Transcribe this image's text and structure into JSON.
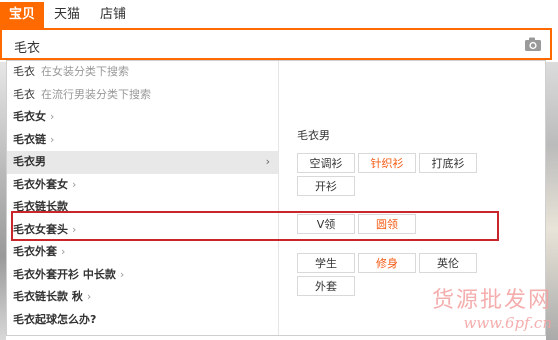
{
  "tabs": [
    {
      "label": "宝贝",
      "active": true
    },
    {
      "label": "天猫",
      "active": false
    },
    {
      "label": "店铺",
      "active": false
    }
  ],
  "search": {
    "value": "毛衣",
    "camera_icon": "camera-icon"
  },
  "suggestions": [
    {
      "keyword": "毛衣",
      "category": "在女装分类下搜索",
      "arrow": ""
    },
    {
      "keyword": "毛衣",
      "category": "在流行男装分类下搜索",
      "arrow": ""
    },
    {
      "keyword": "毛衣女",
      "category": "",
      "arrow": "›"
    },
    {
      "keyword": "毛衣链",
      "category": "",
      "arrow": "›"
    },
    {
      "keyword": "毛衣男",
      "category": "",
      "arrow": "›",
      "active": true
    },
    {
      "keyword": "毛衣外套女",
      "category": "",
      "arrow": "›"
    },
    {
      "keyword": "毛衣链长款",
      "category": "",
      "arrow": ""
    },
    {
      "keyword": "毛衣女套头",
      "category": "",
      "arrow": "›"
    },
    {
      "keyword": "毛衣外套",
      "category": "",
      "arrow": "›"
    },
    {
      "keyword": "毛衣外套开衫 中长款",
      "category": "",
      "arrow": "›"
    },
    {
      "keyword": "毛衣链长款 秋",
      "category": "",
      "arrow": "›"
    },
    {
      "keyword": "毛衣起球怎么办?",
      "category": "",
      "arrow": ""
    }
  ],
  "panel": {
    "title": "毛衣男",
    "groups": [
      {
        "items": [
          {
            "label": "空调衫",
            "highlight": false
          },
          {
            "label": "针织衫",
            "highlight": true
          },
          {
            "label": "打底衫",
            "highlight": false
          },
          {
            "label": "开衫",
            "highlight": false
          }
        ]
      },
      {
        "items": [
          {
            "label": "V领",
            "highlight": false
          },
          {
            "label": "圆领",
            "highlight": true
          }
        ]
      },
      {
        "items": [
          {
            "label": "学生",
            "highlight": false
          },
          {
            "label": "修身",
            "highlight": true
          },
          {
            "label": "英伦",
            "highlight": false
          },
          {
            "label": "外套",
            "highlight": false
          }
        ]
      }
    ]
  },
  "watermark": {
    "cn": "货源批发网",
    "url": "www.6pf.cn"
  },
  "colors": {
    "accent": "#ff6a00",
    "highlight_text": "#f35b13",
    "annotation_box": "#c8262a"
  }
}
